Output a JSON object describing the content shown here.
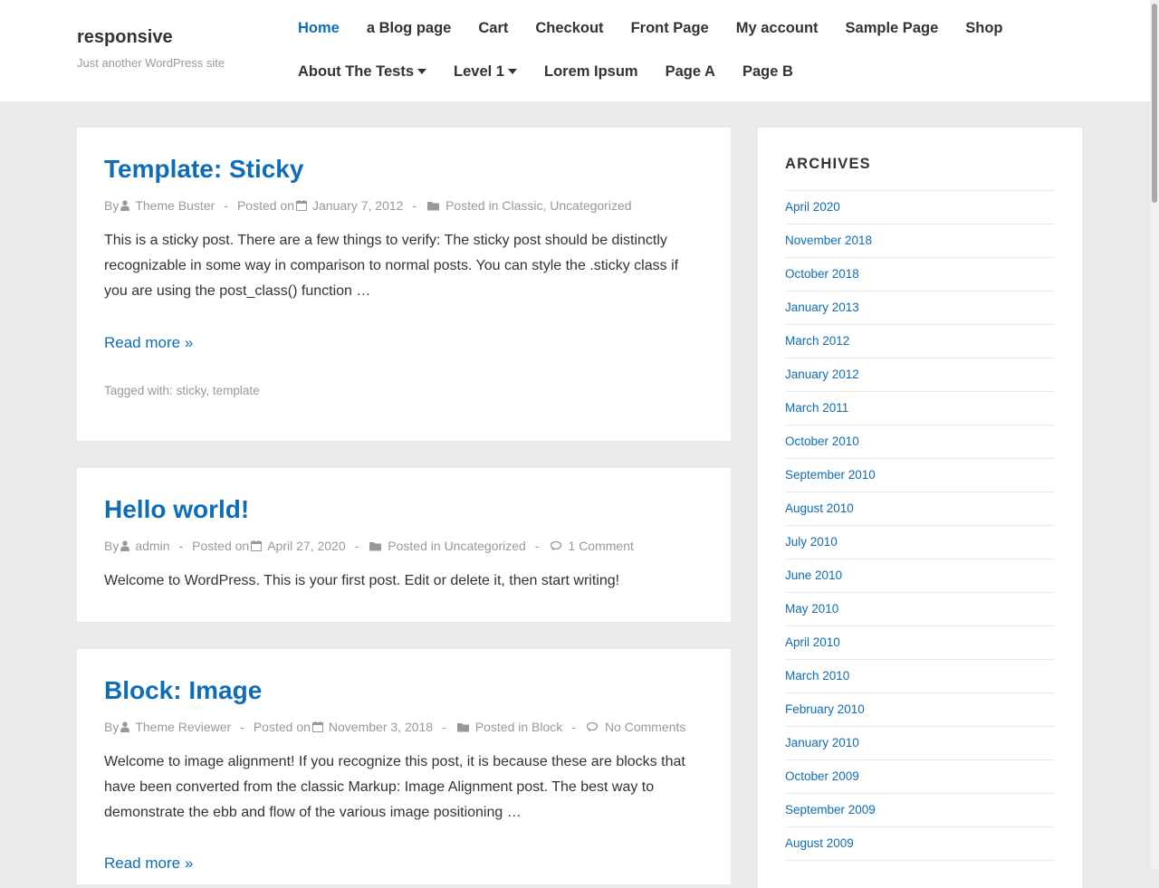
{
  "site": {
    "title": "responsive",
    "description": "Just another WordPress site"
  },
  "nav": {
    "row1": [
      "Home",
      "a Blog page",
      "Cart",
      "Checkout",
      "Front Page",
      "My account",
      "Sample Page",
      "Shop"
    ],
    "row2": [
      "About The Tests",
      "Level 1",
      "Lorem Ipsum",
      "Page A",
      "Page B"
    ]
  },
  "posts": [
    {
      "title": "Template: Sticky",
      "by": "By",
      "author": "Theme Buster",
      "posted_on": "Posted on",
      "date": "January 7, 2012",
      "posted_in": "Posted in",
      "category": "Classic, Uncategorized",
      "excerpt": "This is a sticky post. There are a few things to verify: The sticky post should be distinctly recognizable in some way in comparison to normal posts. You can style the .sticky class if you are using the post_class() function …",
      "read_more": "Read more »",
      "tags_label": "Tagged with:",
      "tags": "sticky, template"
    },
    {
      "title": "Hello world!",
      "by": "By",
      "author": "admin",
      "posted_on": "Posted on",
      "date": "April 27, 2020",
      "posted_in": "Posted in",
      "category": "Uncategorized",
      "comments": "1 Comment",
      "excerpt": "Welcome to WordPress. This is your first post. Edit or delete it, then start writing!"
    },
    {
      "title": "Block: Image",
      "by": "By",
      "author": "Theme Reviewer",
      "posted_on": "Posted on",
      "date": "November 3, 2018",
      "posted_in": "Posted in",
      "category": "Block",
      "comments": "No Comments",
      "excerpt": "Welcome to image alignment! If you recognize this post, it is because these are blocks that have been converted from the classic Markup: Image Alignment post. The best way to demonstrate the ebb and flow of the various image positioning …",
      "read_more": "Read more »"
    }
  ],
  "sidebar": {
    "title": "ARCHIVES",
    "archives": [
      "April 2020",
      "November 2018",
      "October 2018",
      "January 2013",
      "March 2012",
      "January 2012",
      "March 2011",
      "October 2010",
      "September 2010",
      "August 2010",
      "July 2010",
      "June 2010",
      "May 2010",
      "April 2010",
      "March 2010",
      "February 2010",
      "January 2010",
      "October 2009",
      "September 2009",
      "August 2009"
    ]
  },
  "colors": {
    "link": "#0f6cb8",
    "meta": "#999999",
    "background": "#eaeaea"
  },
  "icons": [
    "user-icon",
    "calendar-icon",
    "folder-icon",
    "comments-icon",
    "caret-down-icon"
  ]
}
